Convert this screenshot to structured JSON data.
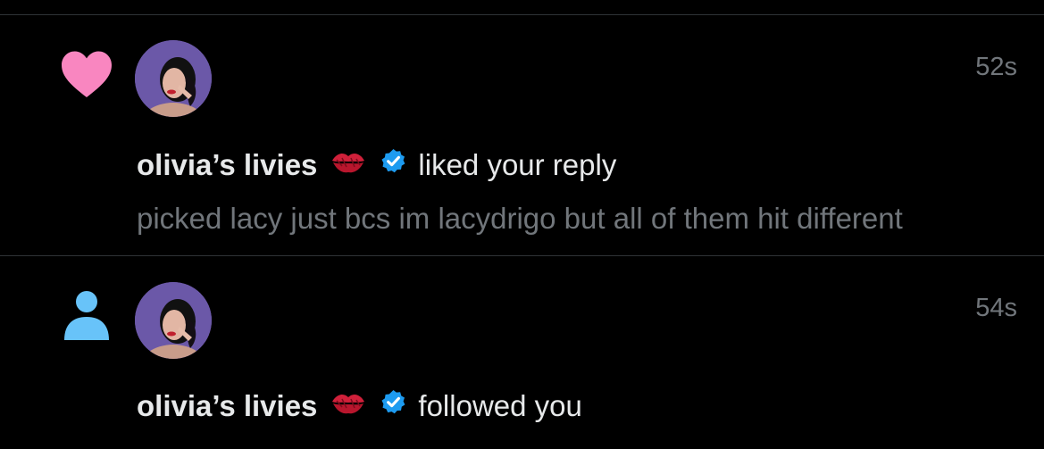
{
  "notifications": [
    {
      "type_icon": "heart-icon",
      "type_color": "#f986c0",
      "user_name": "olivia’s livies",
      "name_emoji": "kiss-mark-icon",
      "verified": true,
      "action": "liked your reply",
      "preview": "picked lacy just bcs im lacydrigo but all of them hit different",
      "time": "52s"
    },
    {
      "type_icon": "person-icon",
      "type_color": "#68c3f9",
      "user_name": "olivia’s livies",
      "name_emoji": "kiss-mark-icon",
      "verified": true,
      "action": "followed you",
      "time": "54s"
    }
  ],
  "colors": {
    "background": "#000000",
    "verified_badge": "#1d9bf0",
    "secondary_text": "#71767b"
  }
}
